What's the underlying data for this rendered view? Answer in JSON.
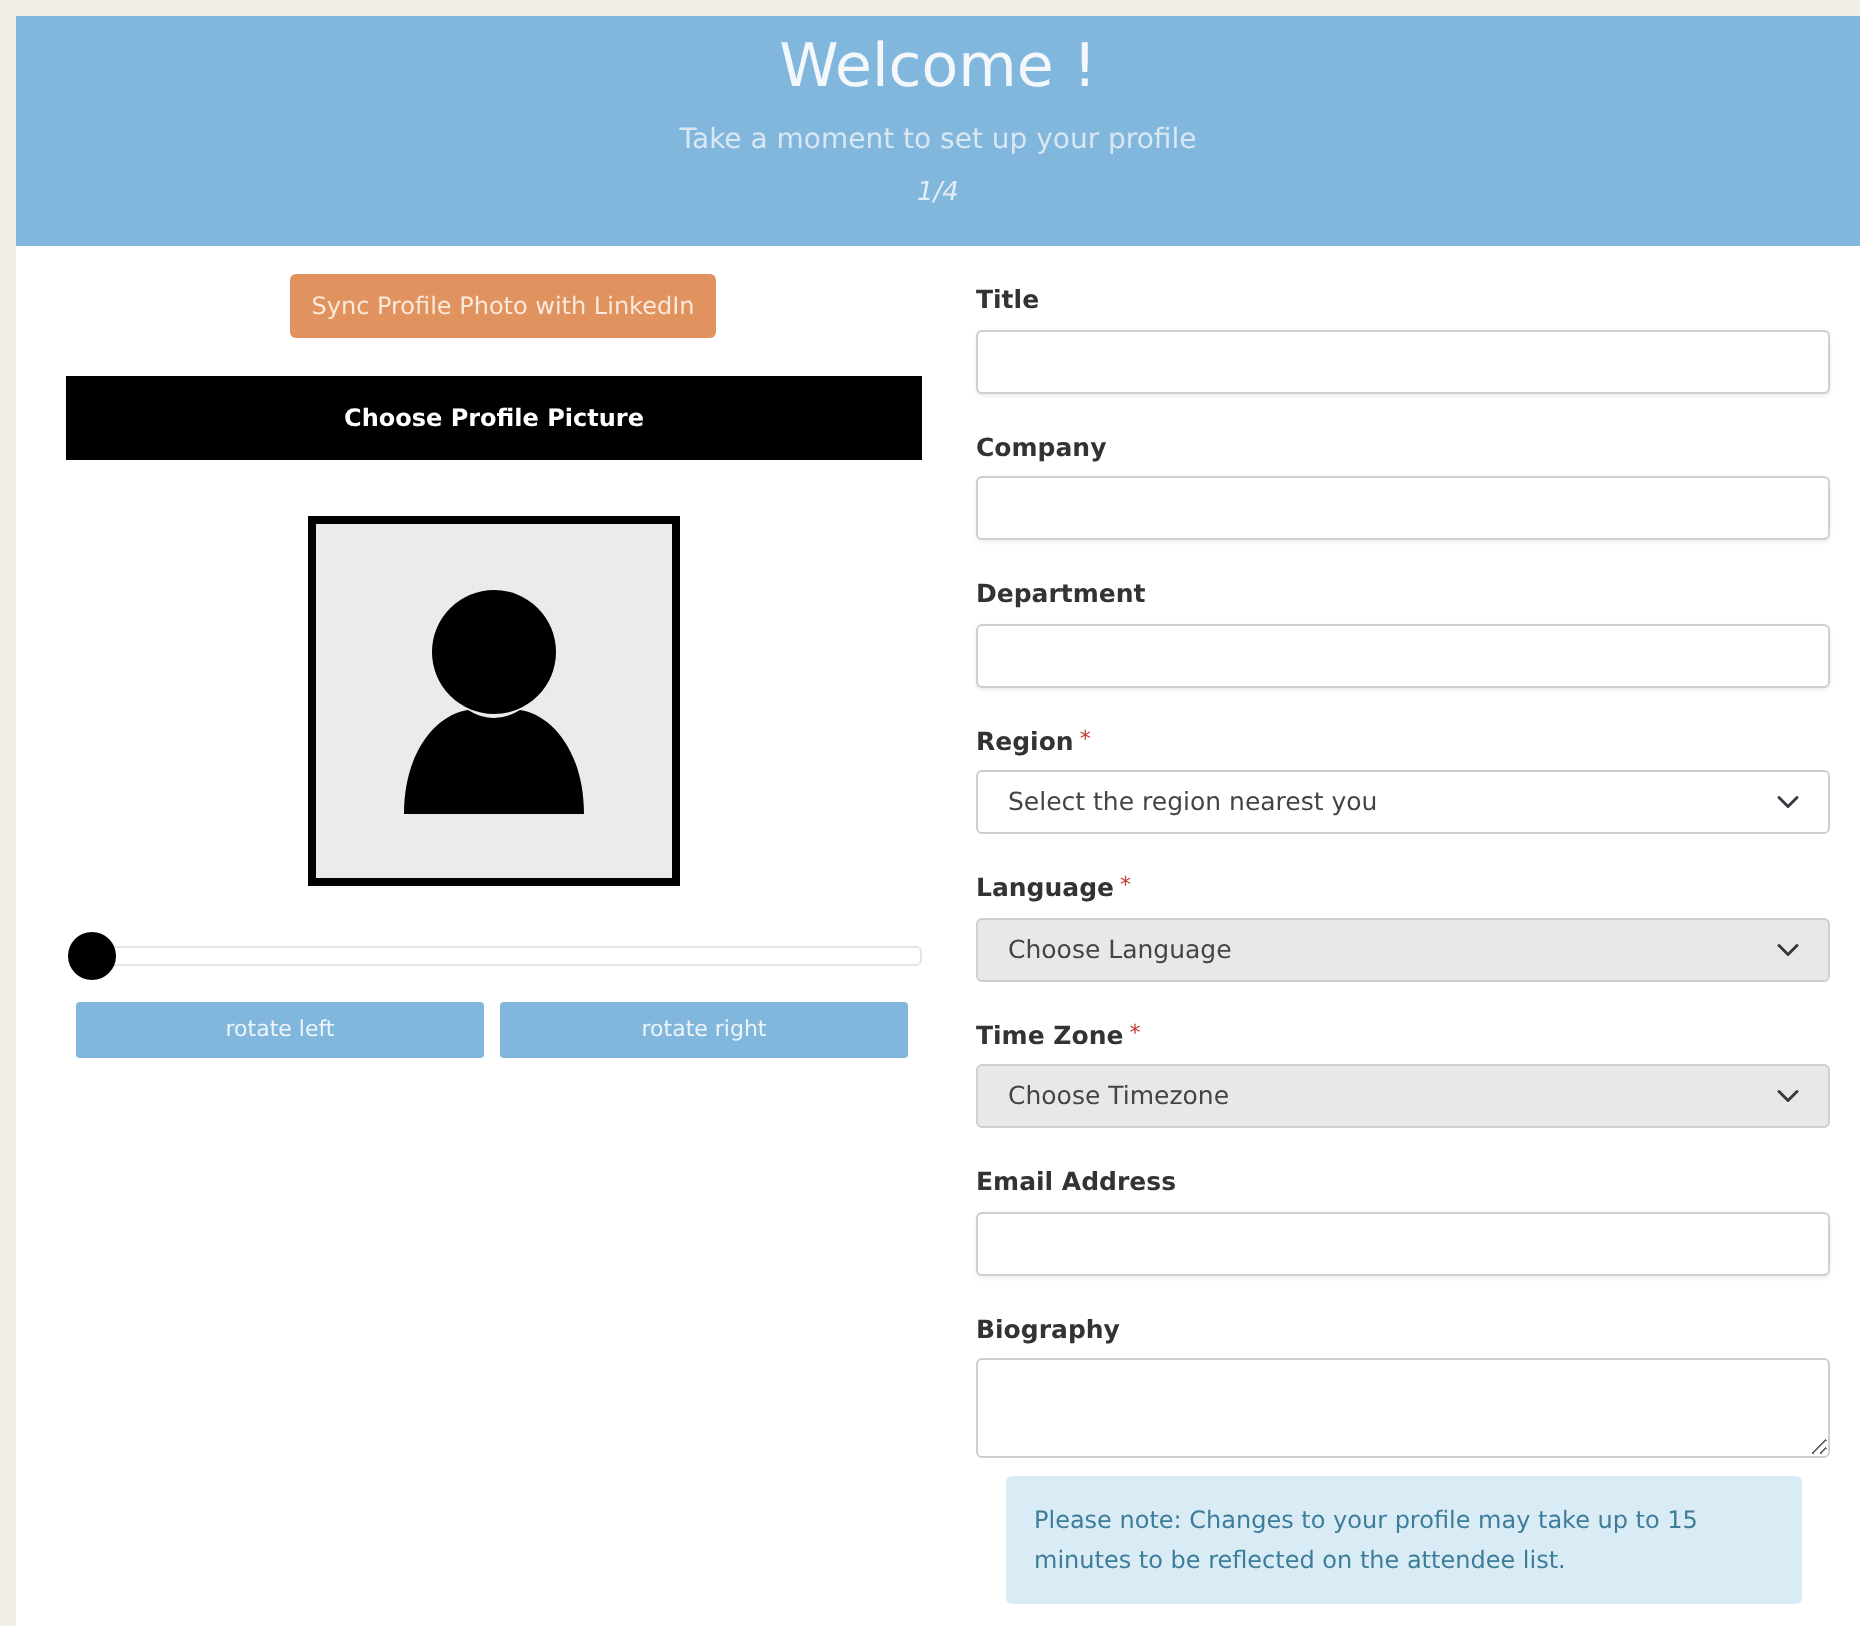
{
  "header": {
    "title": "Welcome !",
    "subtitle": "Take a moment to set up your profile",
    "step": "1/4"
  },
  "photo": {
    "sync_button": "Sync Profile Photo with LinkedIn",
    "choose_button": "Choose Profile Picture",
    "zoom_slider": {
      "level": 0
    },
    "rotate_buttons": [
      "rotate left",
      "rotate right"
    ]
  },
  "fields": [
    {
      "kind": "text",
      "label": "Title"
    },
    {
      "kind": "text",
      "label": "Company"
    },
    {
      "kind": "text",
      "label": "Department"
    },
    {
      "kind": "select",
      "label": "Region",
      "required_mark": "*",
      "value": "Select the region nearest you",
      "disabled": false
    },
    {
      "kind": "select",
      "label": "Language",
      "required_mark": "*",
      "value": "Choose Language",
      "disabled": true
    },
    {
      "kind": "select",
      "label": "Time Zone",
      "required_mark": "*",
      "value": "Choose Timezone",
      "disabled": true
    },
    {
      "kind": "text",
      "label": "Email Address"
    },
    {
      "kind": "textarea",
      "label": "Biography"
    }
  ],
  "note": "Please note: Changes to your profile may take up to 15 minutes to be reflected on the attendee list."
}
